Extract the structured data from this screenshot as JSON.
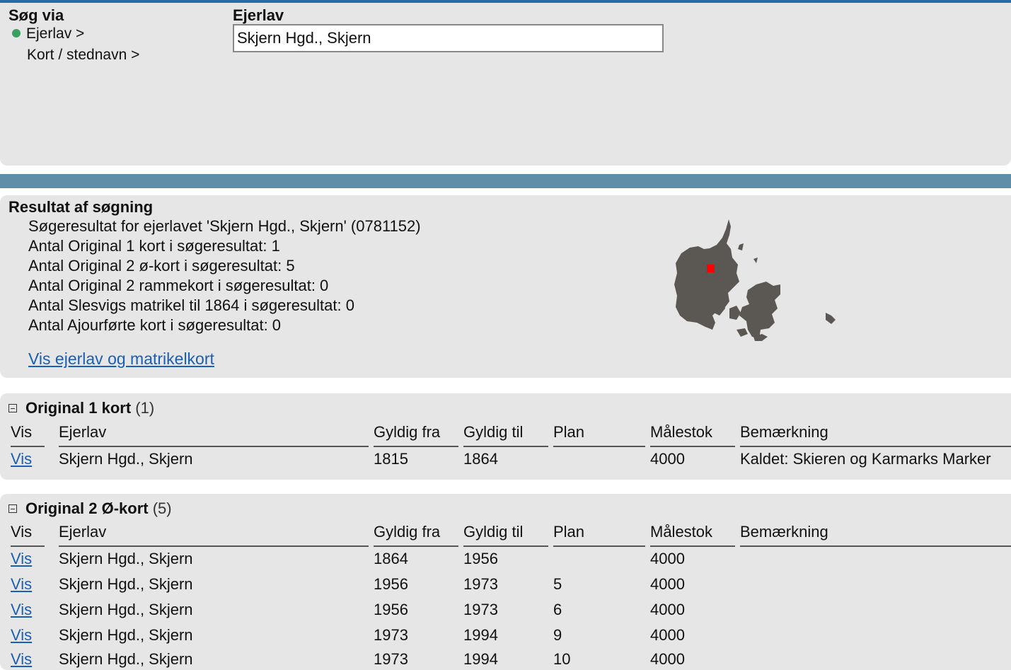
{
  "search": {
    "title": "Søg via",
    "options": [
      "Ejerlav >",
      "Kort / stednavn >"
    ],
    "ejerlav_label": "Ejerlav",
    "ejerlav_value": "Skjern Hgd., Skjern"
  },
  "result": {
    "title": "Resultat af søgning",
    "lines": [
      "Søgeresultat for ejerlavet 'Skjern Hgd., Skjern' (0781152)",
      "Antal Original 1 kort i søgeresultat: 1",
      "Antal Original 2 ø-kort i søgeresultat: 5",
      "Antal Original 2 rammekort i søgeresultat: 0",
      "Antal Slesvigs matrikel til 1864 i søgeresultat: 0",
      "Antal Ajourførte kort i søgeresultat: 0"
    ],
    "link": "Vis ejerlav og matrikelkort"
  },
  "columns": [
    "Vis",
    "Ejerlav",
    "Gyldig fra",
    "Gyldig til",
    "Plan",
    "Målestok",
    "Bemærkning"
  ],
  "table1": {
    "title": "Original 1 kort",
    "count": "(1)",
    "rows": [
      {
        "vis": "Vis",
        "ejerlav": "Skjern Hgd., Skjern",
        "fra": "1815",
        "til": "1864",
        "plan": "",
        "malestok": "4000",
        "bemaerkning": "Kaldet: Skieren og Karmarks Marker"
      }
    ]
  },
  "table2": {
    "title": "Original 2 Ø-kort",
    "count": "(5)",
    "rows": [
      {
        "vis": "Vis",
        "ejerlav": "Skjern Hgd., Skjern",
        "fra": "1864",
        "til": "1956",
        "plan": "",
        "malestok": "4000",
        "bemaerkning": ""
      },
      {
        "vis": "Vis",
        "ejerlav": "Skjern Hgd., Skjern",
        "fra": "1956",
        "til": "1973",
        "plan": "5",
        "malestok": "4000",
        "bemaerkning": ""
      },
      {
        "vis": "Vis",
        "ejerlav": "Skjern Hgd., Skjern",
        "fra": "1956",
        "til": "1973",
        "plan": "6",
        "malestok": "4000",
        "bemaerkning": ""
      },
      {
        "vis": "Vis",
        "ejerlav": "Skjern Hgd., Skjern",
        "fra": "1973",
        "til": "1994",
        "plan": "9",
        "malestok": "4000",
        "bemaerkning": ""
      },
      {
        "vis": "Vis",
        "ejerlav": "Skjern Hgd., Skjern",
        "fra": "1973",
        "til": "1994",
        "plan": "10",
        "malestok": "4000",
        "bemaerkning": ""
      }
    ]
  },
  "colors": {
    "link": "#1a5fb4",
    "band": "#5f8ea8",
    "panel": "#e6e6e6",
    "marker": "#ff0000",
    "map": "#5b5753"
  }
}
